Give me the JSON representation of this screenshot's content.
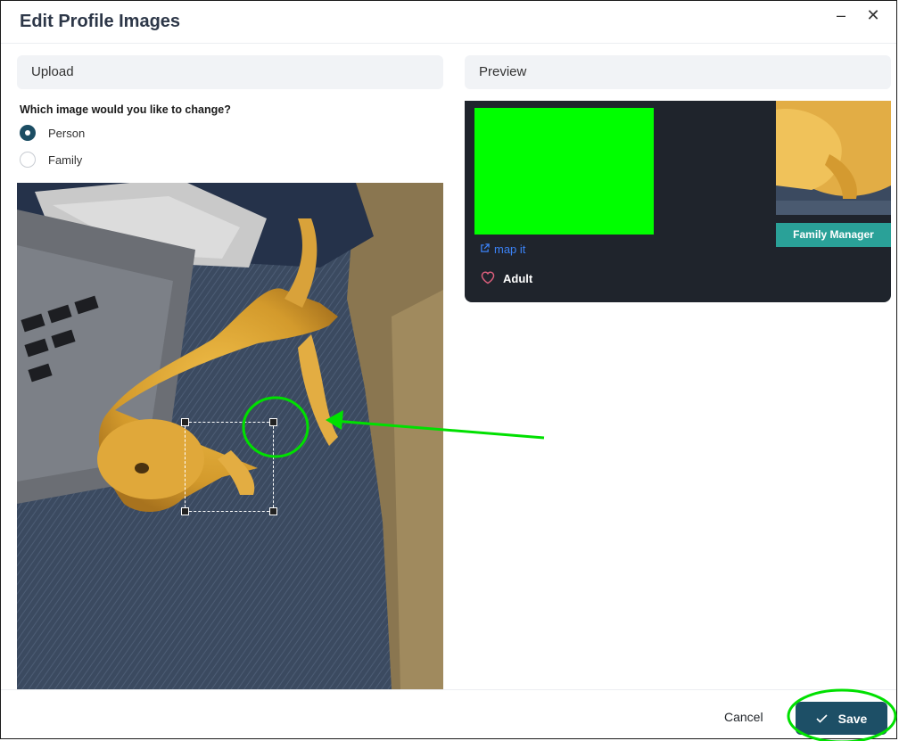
{
  "dialog": {
    "title": "Edit Profile Images",
    "minimize_glyph": "–",
    "close_glyph": "✕"
  },
  "upload": {
    "header": "Upload",
    "question": "Which image would you like to change?",
    "options": [
      {
        "label": "Person",
        "selected": true
      },
      {
        "label": "Family",
        "selected": false
      }
    ],
    "photo_icon": "bearded-dragon-photo"
  },
  "preview": {
    "header": "Preview",
    "map_link": "map it",
    "tag": "Adult",
    "badge": "Family Manager"
  },
  "footer": {
    "cancel": "Cancel",
    "save": "Save"
  },
  "colors": {
    "primary": "#1d4f66",
    "badge": "#2aa198",
    "annotation": "#00e000",
    "placeholder": "#00ff00"
  }
}
